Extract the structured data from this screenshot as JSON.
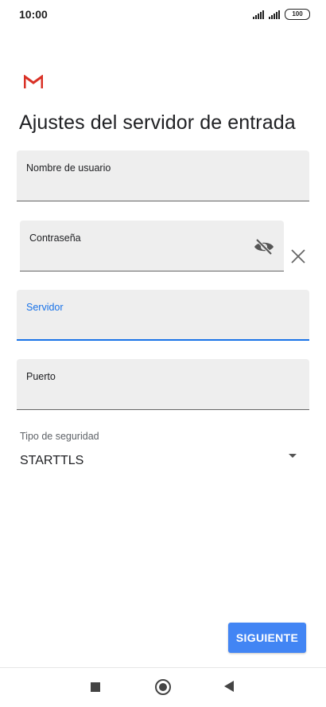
{
  "status_bar": {
    "time": "10:00",
    "battery": "100"
  },
  "page": {
    "title": "Ajustes del servidor de entrada"
  },
  "fields": {
    "username": {
      "label": "Nombre de usuario",
      "value": ""
    },
    "password": {
      "label": "Contraseña",
      "value": ""
    },
    "server": {
      "label": "Servidor",
      "value": ""
    },
    "port": {
      "label": "Puerto",
      "value": ""
    }
  },
  "security": {
    "label": "Tipo de seguridad",
    "value": "STARTTLS"
  },
  "actions": {
    "next_label": "SIGUIENTE"
  },
  "colors": {
    "accent": "#1a73e8",
    "button": "#4285f4",
    "field_bg": "#eeeeee",
    "gmail_red": "#d93025"
  },
  "icons": [
    "gmail-icon",
    "eye-off-icon",
    "close-icon",
    "dropdown-arrow-icon",
    "nav-recents-icon",
    "nav-home-icon",
    "nav-back-icon"
  ]
}
